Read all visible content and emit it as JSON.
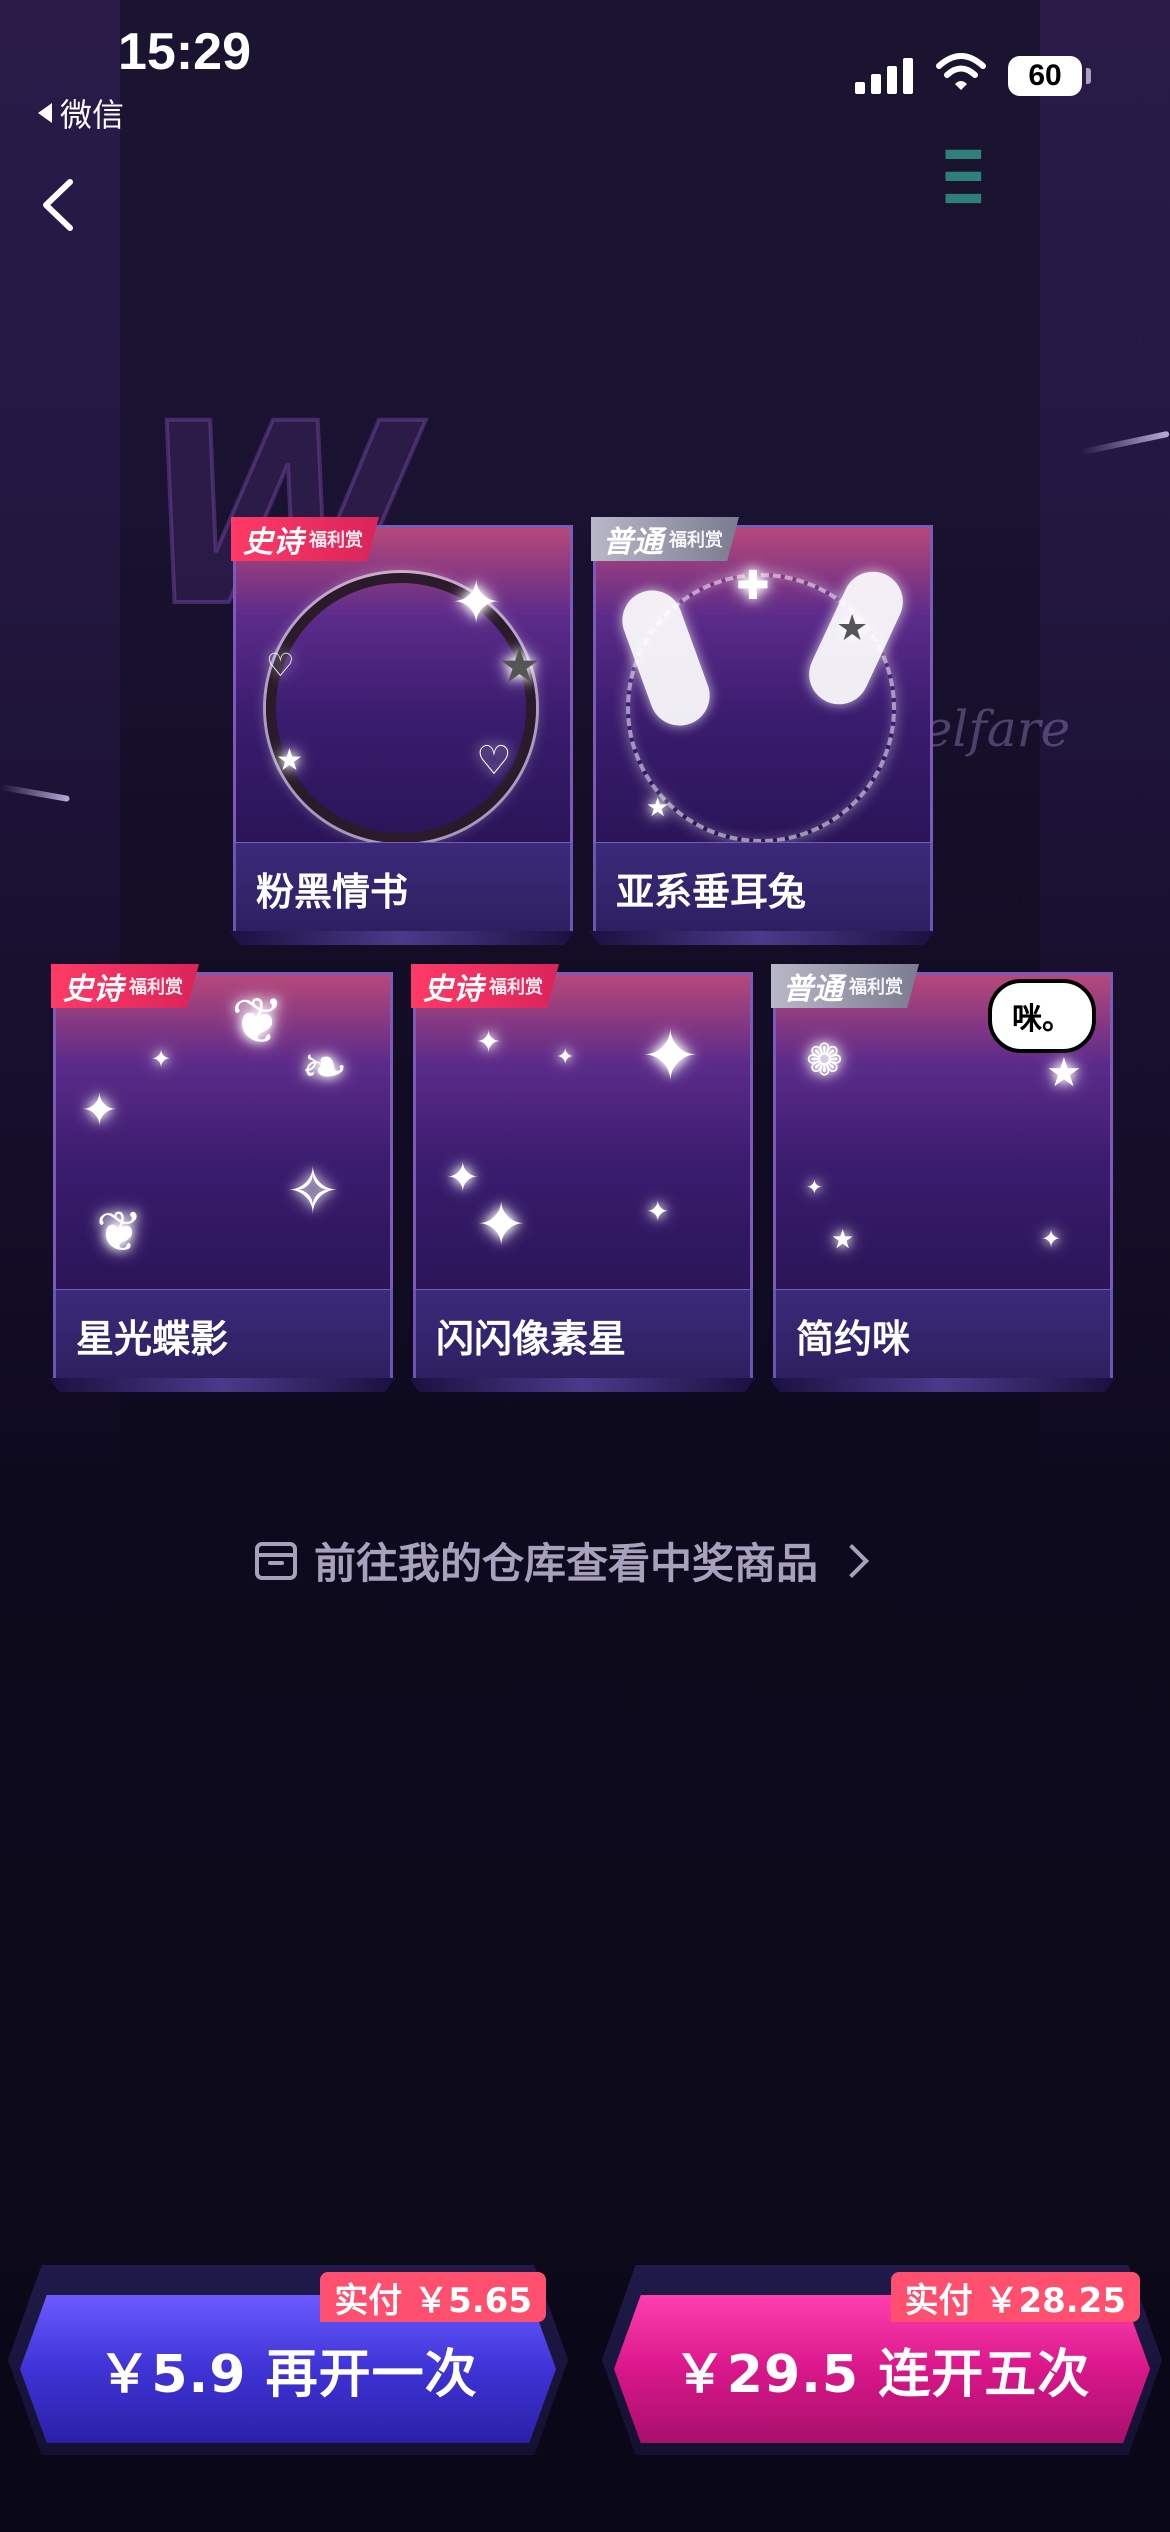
{
  "status_bar": {
    "time": "15:29",
    "back_app": "微信",
    "battery": "60",
    "icons": [
      "signal-icon",
      "wifi-icon",
      "battery-icon"
    ]
  },
  "nav": {
    "back_icon": "chevron-left-icon"
  },
  "background": {
    "decor_text": "welfare"
  },
  "prizes": [
    {
      "name": "粉黑情书",
      "tier_label": "史诗",
      "tier_sub": "福利赏",
      "tier": "epic"
    },
    {
      "name": "亚系垂耳兔",
      "tier_label": "普通",
      "tier_sub": "福利赏",
      "tier": "normal"
    },
    {
      "name": "星光蝶影",
      "tier_label": "史诗",
      "tier_sub": "福利赏",
      "tier": "epic"
    },
    {
      "name": "闪闪像素星",
      "tier_label": "史诗",
      "tier_sub": "福利赏",
      "tier": "epic"
    },
    {
      "name": "简约咪",
      "tier_label": "普通",
      "tier_sub": "福利赏",
      "tier": "normal",
      "bubble": "咪。"
    }
  ],
  "warehouse_link": {
    "text": "前往我的仓库查看中奖商品"
  },
  "buttons": {
    "again": {
      "label": "￥5.9 再开一次",
      "pay": "实付 ￥5.65"
    },
    "five": {
      "label": "￥29.5 连开五次",
      "pay": "实付 ￥28.25"
    }
  },
  "colors": {
    "epic": "#ff3a66",
    "normal": "#9a9aaf",
    "blue_button": "#4a3de6",
    "pink_button": "#e01c92"
  }
}
